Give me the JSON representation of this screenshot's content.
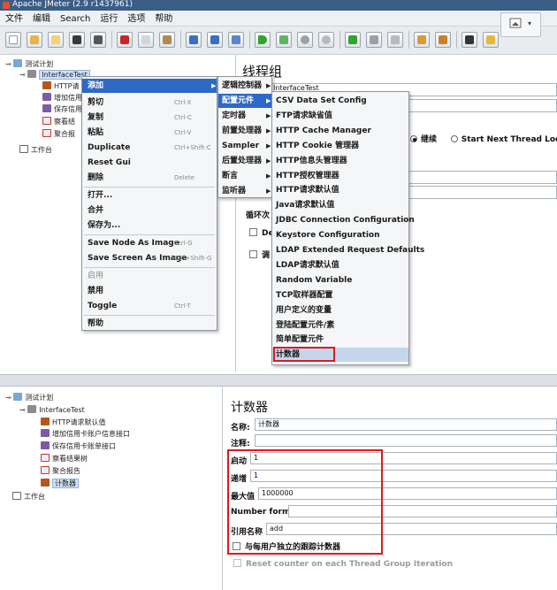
{
  "window": {
    "title": "Apache JMeter (2.9 r1437961)"
  },
  "menubar": [
    "文件",
    "编辑",
    "Search",
    "运行",
    "选项",
    "帮助"
  ],
  "tree_top": {
    "root": "测试计划",
    "items": [
      "InterfaceTest",
      "HTTP请",
      "增加信用",
      "保存信用",
      "察看结",
      "聚合报",
      "工作台"
    ]
  },
  "right_top": {
    "title": "线程组",
    "name_value": "InterfaceTest",
    "radio_continue": "继续",
    "radio_start_next": "Start Next Thread Loop",
    "loop_label": "循环次",
    "chk1": "De",
    "chk2": "调"
  },
  "context_menu": {
    "items": [
      {
        "label": "添加",
        "shortcut": ""
      },
      {
        "label": "剪切",
        "shortcut": "Ctrl-X"
      },
      {
        "label": "复制",
        "shortcut": "Ctrl-C"
      },
      {
        "label": "粘贴",
        "shortcut": "Ctrl-V"
      },
      {
        "label": "Duplicate",
        "shortcut": "Ctrl+Shift-C"
      },
      {
        "label": "Reset Gui",
        "shortcut": ""
      },
      {
        "label": "删除",
        "shortcut": "Delete"
      },
      {
        "label": "打开...",
        "shortcut": ""
      },
      {
        "label": "合并",
        "shortcut": ""
      },
      {
        "label": "保存为...",
        "shortcut": ""
      },
      {
        "label": "Save Node As Image",
        "shortcut": "Ctrl-G"
      },
      {
        "label": "Save Screen As Image",
        "shortcut": "Ctrl+Shift-G"
      },
      {
        "label": "启用",
        "shortcut": ""
      },
      {
        "label": "禁用",
        "shortcut": ""
      },
      {
        "label": "Toggle",
        "shortcut": "Ctrl-T"
      },
      {
        "label": "帮助",
        "shortcut": ""
      }
    ]
  },
  "add_submenu": [
    "逻辑控制器",
    "配置元件",
    "定时器",
    "前置处理器",
    "Sampler",
    "后置处理器",
    "断言",
    "监听器"
  ],
  "config_submenu": [
    "CSV Data Set Config",
    "FTP请求缺省值",
    "HTTP Cache Manager",
    "HTTP Cookie 管理器",
    "HTTP信息头管理器",
    "HTTP授权管理器",
    "HTTP请求默认值",
    "Java请求默认值",
    "JDBC Connection Configuration",
    "Keystore Configuration",
    "LDAP Extended Request Defaults",
    "LDAP请求默认值",
    "Random Variable",
    "TCP取样器配置",
    "用户定义的变量",
    "登陆配置元件/素",
    "简单配置元件",
    "计数器"
  ],
  "tree_bottom": {
    "root": "测试计划",
    "items": [
      "InterfaceTest",
      "HTTP请求默认值",
      "增加信用卡账户信息接口",
      "保存信用卡账单接口",
      "察看结果树",
      "聚合报告",
      "计数器",
      "工作台"
    ]
  },
  "counter_panel": {
    "title": "计数器",
    "name_label": "名称:",
    "name_value": "计数器",
    "comment_label": "注释:",
    "start_label": "启动",
    "start_value": "1",
    "incr_label": "递增",
    "incr_value": "1",
    "max_label": "最大值",
    "max_value": "1000000",
    "format_label": "Number format",
    "format_value": "",
    "ref_label": "引用名称",
    "ref_value": "add",
    "per_user_label": "与每用户独立的跟踪计数器",
    "reset_label": "Reset counter on each Thread Group Iteration"
  },
  "colors": {
    "highlight": "#2f69c7",
    "redbox": "#e0191f"
  }
}
